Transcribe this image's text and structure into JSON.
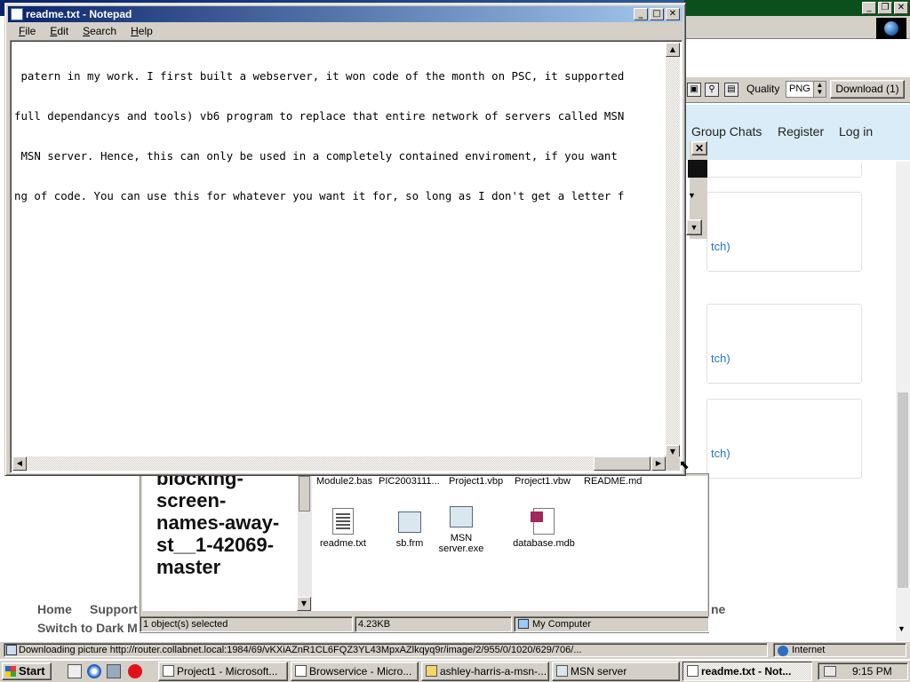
{
  "browser": {
    "toolbar": {
      "quality_label": "Quality",
      "quality_value": "PNG",
      "download_label": "Download (1)"
    },
    "page_nav": [
      "Group Chats",
      "Register",
      "Log in"
    ],
    "watch_fragment": "tch)",
    "footer_links": [
      "Home",
      "Support"
    ],
    "footer_fragment": "Switch to Dark M",
    "footer_right_fragment": "ne",
    "status_text": "Downloading picture http://router.collabnet.local:1984/69/vKXiAZnR1CL6FQZ3YL43MpxAZlkqyq9r/image/2/955/0/1020/629/706/...",
    "zone": "Internet"
  },
  "explorer": {
    "folder_title_text": "blocking-screen-names-away-st__1-42069-master",
    "top_files": [
      "Module2.bas",
      "PIC2003111...",
      "Project1.vbp",
      "Project1.vbw",
      "README.md"
    ],
    "files": [
      {
        "name": "readme.txt",
        "kind": "text"
      },
      {
        "name": "sb.frm",
        "kind": "form"
      },
      {
        "name": "MSN server.exe",
        "kind": "exe"
      },
      {
        "name": "database.mdb",
        "kind": "access"
      }
    ],
    "status": {
      "selected": "1 object(s) selected",
      "size": "4.23KB",
      "location": "My Computer"
    }
  },
  "notepad": {
    "title": "readme.txt - Notepad",
    "menus": [
      {
        "underline": "F",
        "rest": "ile"
      },
      {
        "underline": "E",
        "rest": "dit"
      },
      {
        "underline": "S",
        "rest": "earch"
      },
      {
        "underline": "H",
        "rest": "elp"
      }
    ],
    "lines": [
      " patern in my work. I first built a webserver, it won code of the month on PSC, it supported",
      "full dependancys and tools) vb6 program to replace that entire network of servers called MSN",
      " MSN server. Hence, this can only be used in a completely contained enviroment, if you want",
      "ng of code. You can use this for whatever you want it for, so long as I don't get a letter f"
    ]
  },
  "taskbar": {
    "start_label": "Start",
    "tasks": [
      {
        "label": "Project1 - Microsoft...",
        "active": false
      },
      {
        "label": "Browservice - Micro...",
        "active": false
      },
      {
        "label": "ashley-harris-a-msn-...",
        "active": false
      },
      {
        "label": "MSN server",
        "active": false
      },
      {
        "label": "readme.txt - Not...",
        "active": true
      }
    ],
    "clock": "9:15 PM"
  }
}
